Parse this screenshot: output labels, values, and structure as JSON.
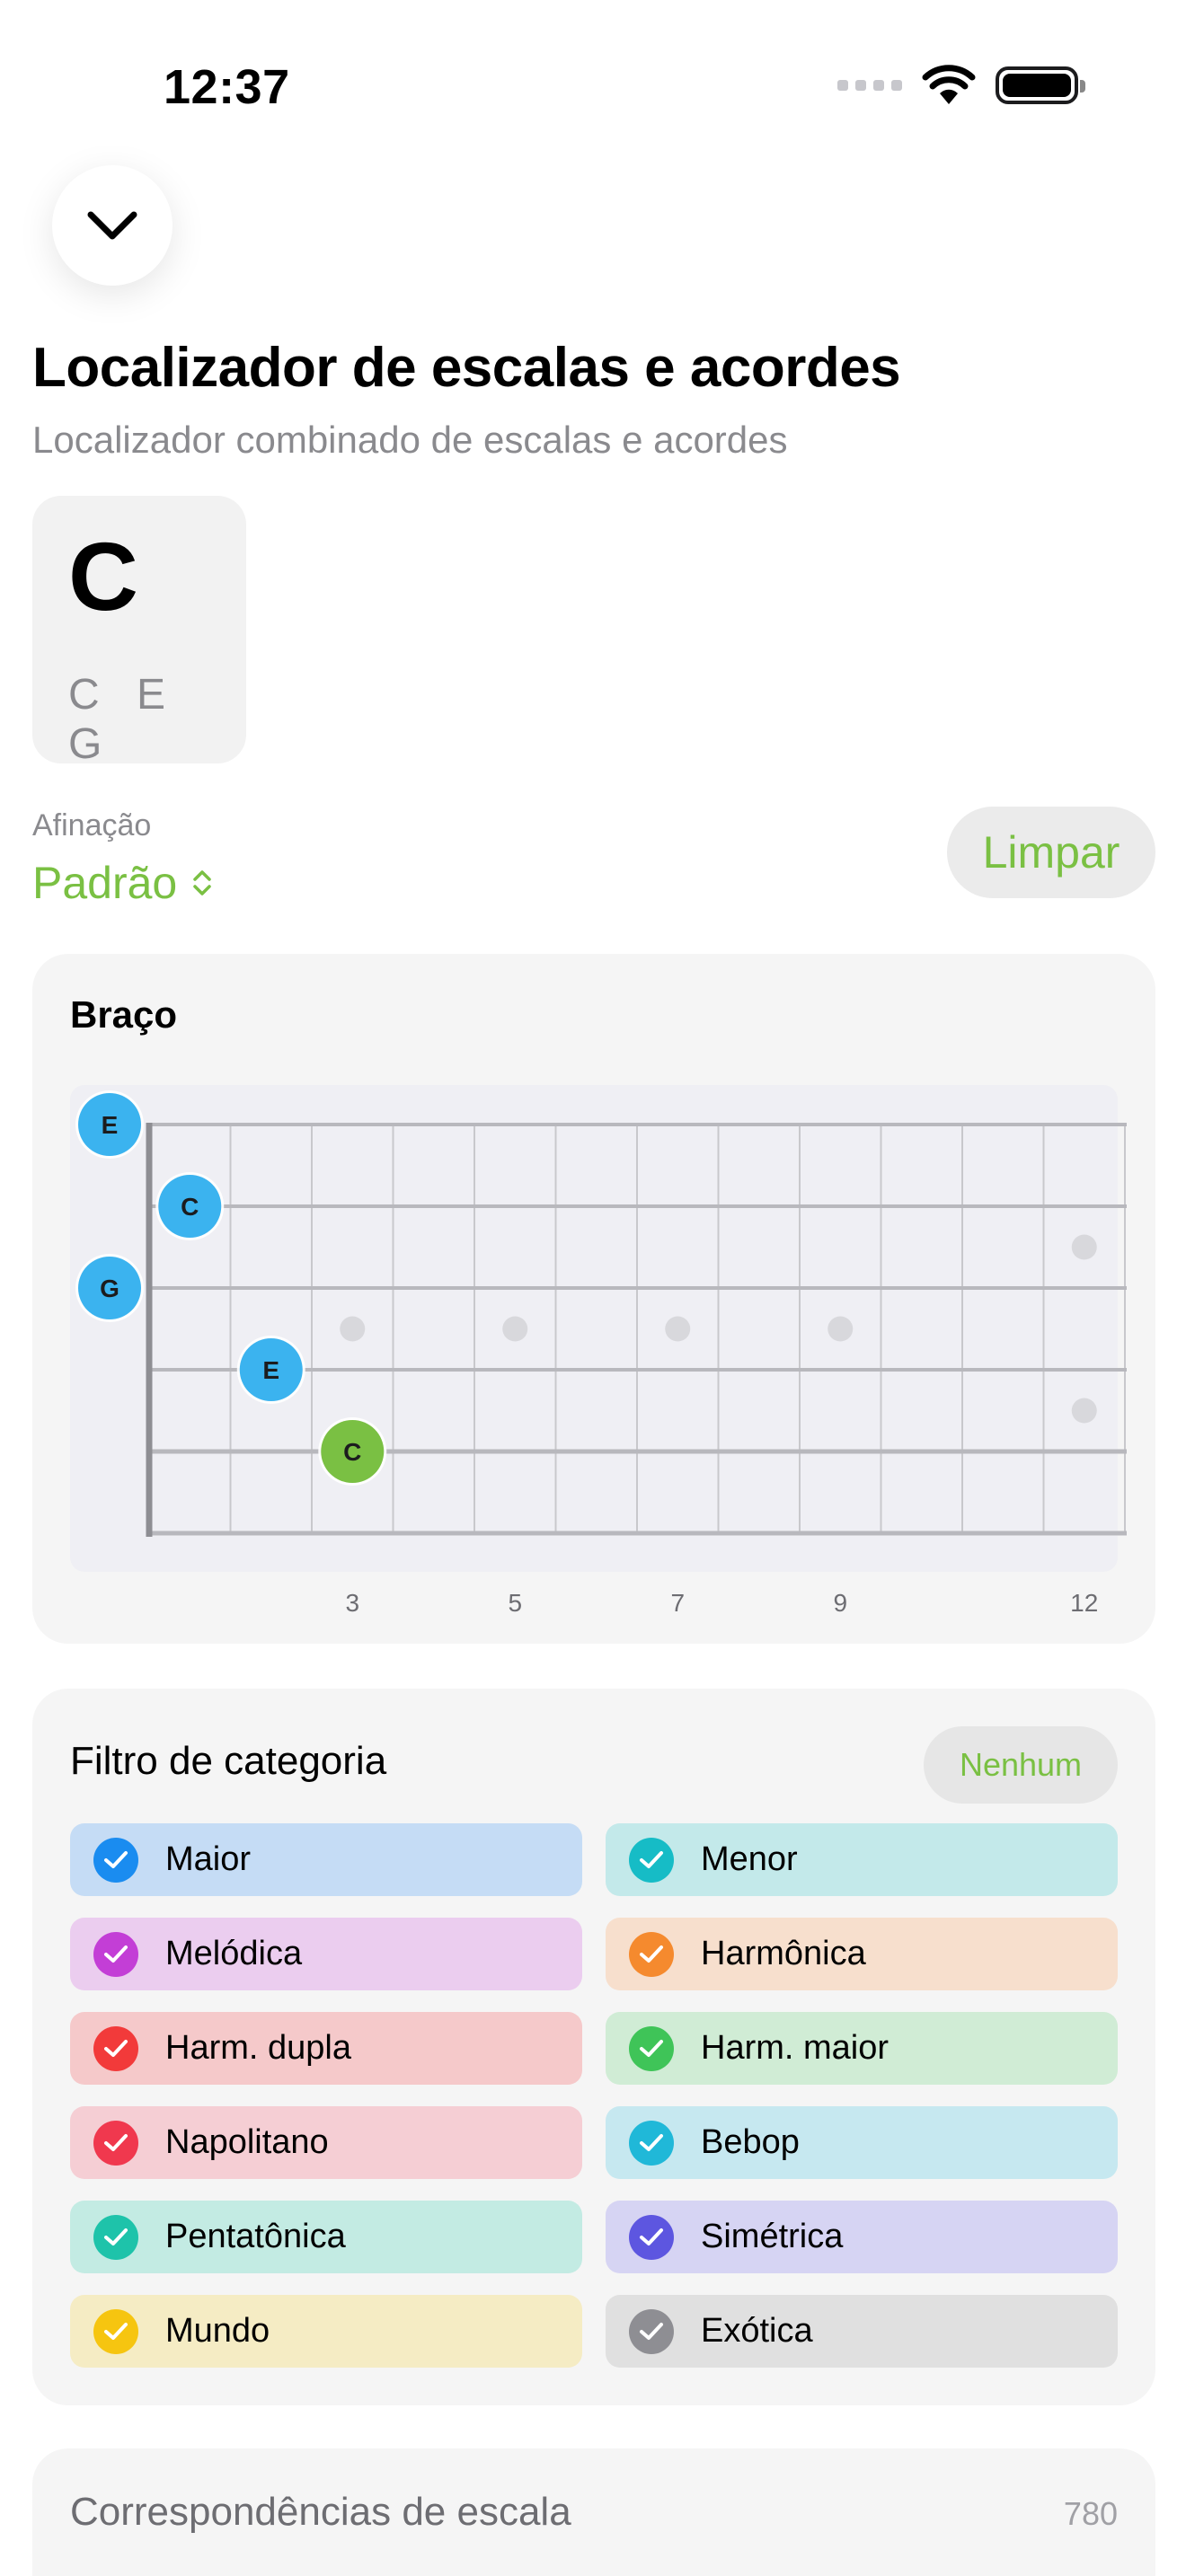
{
  "status": {
    "time": "12:37"
  },
  "header": {
    "title": "Localizador de escalas e acordes",
    "subtitle": "Localizador combinado de escalas e acordes"
  },
  "chord": {
    "name": "C",
    "notes": "C E G"
  },
  "tuning": {
    "label": "Afinação",
    "value": "Padrão",
    "clear_label": "Limpar"
  },
  "fretboard": {
    "title": "Braço",
    "fret_labels": [
      "3",
      "5",
      "7",
      "9",
      "12"
    ],
    "notes": [
      {
        "label": "E",
        "string": 1,
        "fret": 0,
        "color": "#3bb3ef"
      },
      {
        "label": "C",
        "string": 2,
        "fret": 1,
        "color": "#3bb3ef"
      },
      {
        "label": "G",
        "string": 3,
        "fret": 0,
        "color": "#3bb3ef"
      },
      {
        "label": "E",
        "string": 4,
        "fret": 2,
        "color": "#3bb3ef"
      },
      {
        "label": "C",
        "string": 5,
        "fret": 3,
        "color": "#7ac043",
        "root": true
      }
    ]
  },
  "category_filter": {
    "title": "Filtro de categoria",
    "none_label": "Nenhum",
    "items": [
      {
        "label": "Maior",
        "icon_color": "#1a8cf0",
        "bg": "#c5dcf5"
      },
      {
        "label": "Menor",
        "icon_color": "#16bcc6",
        "bg": "#c3e9ea"
      },
      {
        "label": "Melódica",
        "icon_color": "#c33ed6",
        "bg": "#ebcdef"
      },
      {
        "label": "Harmônica",
        "icon_color": "#f58a2e",
        "bg": "#f7dfcd"
      },
      {
        "label": "Harm. dupla",
        "icon_color": "#f23a3a",
        "bg": "#f5c9ca"
      },
      {
        "label": "Harm. maior",
        "icon_color": "#3fc458",
        "bg": "#d0ecd5"
      },
      {
        "label": "Napolitano",
        "icon_color": "#f0384e",
        "bg": "#f5ced4"
      },
      {
        "label": "Bebop",
        "icon_color": "#20b8d8",
        "bg": "#c6e8f0"
      },
      {
        "label": "Pentatônica",
        "icon_color": "#1ec3aa",
        "bg": "#c3ebe3"
      },
      {
        "label": "Simétrica",
        "icon_color": "#5d56e0",
        "bg": "#d6d4f3"
      },
      {
        "label": "Mundo",
        "icon_color": "#f6c510",
        "bg": "#f5ecc4"
      },
      {
        "label": "Exótica",
        "icon_color": "#8e8e93",
        "bg": "#e0e0e0"
      }
    ]
  },
  "matches": {
    "title": "Correspondências de escala",
    "count": "780"
  }
}
